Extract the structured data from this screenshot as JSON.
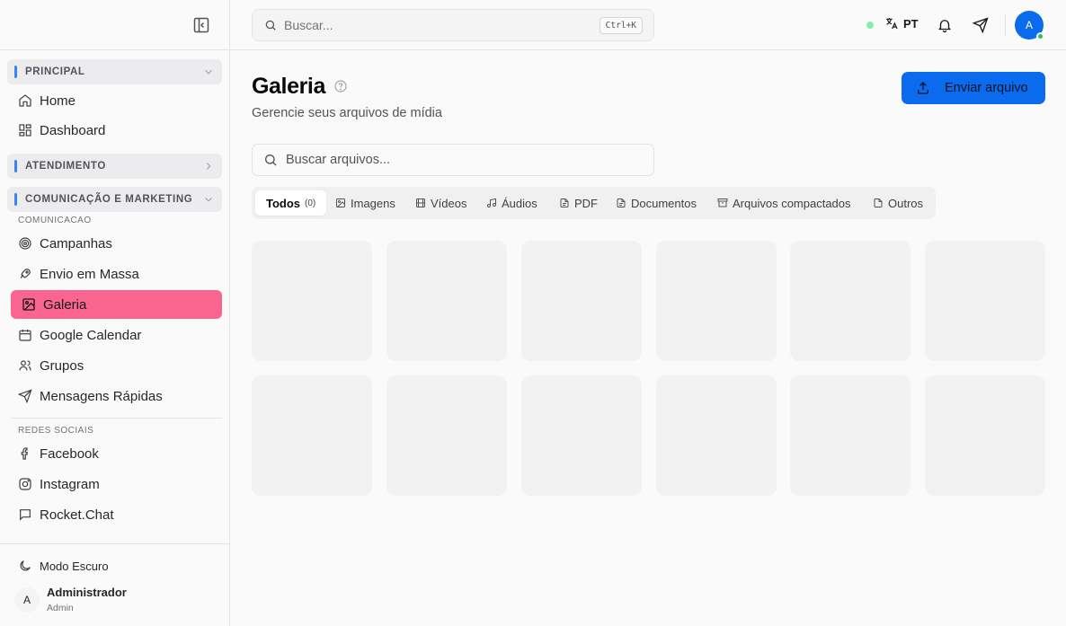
{
  "sidebar": {
    "sections": {
      "principal": "PRINCIPAL",
      "atendimento": "ATENDIMENTO",
      "comunicacao": "COMUNICAÇÃO E MARKETING"
    },
    "principal_items": [
      {
        "label": "Home",
        "icon": "home-icon"
      },
      {
        "label": "Dashboard",
        "icon": "dashboard-icon"
      }
    ],
    "comunicacao_label": "COMUNICACAO",
    "comunicacao_items": [
      {
        "label": "Campanhas",
        "icon": "target-icon"
      },
      {
        "label": "Envio em Massa",
        "icon": "rocket-icon"
      },
      {
        "label": "Galeria",
        "icon": "image-icon",
        "active": true
      },
      {
        "label": "Google Calendar",
        "icon": "calendar-icon"
      },
      {
        "label": "Grupos",
        "icon": "users-icon"
      },
      {
        "label": "Mensagens Rápidas",
        "icon": "send-icon"
      }
    ],
    "redes_label": "REDES SOCIAIS",
    "redes_items": [
      {
        "label": "Facebook",
        "icon": "facebook-icon"
      },
      {
        "label": "Instagram",
        "icon": "instagram-icon"
      },
      {
        "label": "Rocket.Chat",
        "icon": "chat-icon"
      }
    ],
    "dark_mode_label": "Modo Escuro",
    "user": {
      "initial": "A",
      "name": "Administrador",
      "role": "Admin"
    }
  },
  "header": {
    "search_placeholder": "Buscar...",
    "shortcut": "Ctrl+K",
    "language": "PT",
    "avatar_initial": "A"
  },
  "main": {
    "title": "Galeria",
    "subtitle": "Gerencie seus arquivos de mídia",
    "upload_label": "Enviar arquivo",
    "file_search_placeholder": "Buscar arquivos...",
    "tabs": [
      {
        "label": "Todos",
        "count": "(0)"
      },
      {
        "label": "Imagens"
      },
      {
        "label": "Vídeos"
      },
      {
        "label": "Áudios"
      },
      {
        "label": "PDF"
      },
      {
        "label": "Documentos"
      },
      {
        "label": "Arquivos compactados"
      },
      {
        "label": "Outros"
      }
    ]
  },
  "colors": {
    "accent": "#0b6bef",
    "active_nav": "#f9658f",
    "online": "#22c55e",
    "section_bar": "#3b82f6"
  }
}
